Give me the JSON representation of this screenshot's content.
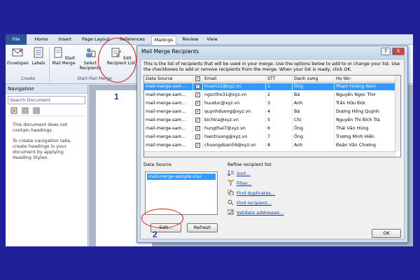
{
  "ribbon": {
    "tabs": [
      "File",
      "Home",
      "Insert",
      "Page Layout",
      "References",
      "Mailings",
      "Review",
      "View"
    ],
    "active_tab": "Mailings",
    "buttons": {
      "envelopes": "Envelopes",
      "labels": "Labels",
      "start_mail_merge": "Start Mail Merge",
      "select_recipients": "Select Recipients",
      "edit_recipient_list": "Edit Recipient List"
    },
    "groups": {
      "create": "Create",
      "start_mail_merge": "Start Mail Merge"
    }
  },
  "navigation": {
    "title": "Navigation",
    "search_placeholder": "Search Document",
    "message1": "This document does not contain headings.",
    "message2": "To create navigation tabs, create headings in your document by applying Heading Styles."
  },
  "dialog": {
    "title": "Mail Merge Recipients",
    "help_btn": "?",
    "close_btn": "X",
    "description": "This is the list of recipients that will be used in your merge.  Use the options below to add to or change your list.  Use the checkboxes to add or remove recipients from the merge.  When your list is ready, click OK.",
    "columns": [
      "Data Source",
      "",
      "Email",
      "STT",
      "Danh xưng",
      "Họ tên"
    ],
    "rows": [
      [
        "mail-merge-sam...",
        "hnam12@xyz.vn",
        "1",
        "Ông",
        "Phạm Hoàng Nam"
      ],
      [
        "mail-merge-sam...",
        "ngoctho31@xyz.vn",
        "2",
        "Bà",
        "Nguyễn Ngọc Thơ"
      ],
      [
        "mail-merge-sam...",
        "huuduc@xyz.vn",
        "3",
        "Anh",
        "Trần Hữu Đức"
      ],
      [
        "mail-merge-sam...",
        "quynhduong@xyz.vn",
        "4",
        "Bà",
        "Dương Hồng Quỳnh"
      ],
      [
        "mail-merge-sam...",
        "bichtra@xyz.vn",
        "5",
        "Chị",
        "Nguyễn Thị Bích Trà"
      ],
      [
        "mail-merge-sam...",
        "hungthai7@xyz.vn",
        "6",
        "Ông",
        "Thái Văn Hùng"
      ],
      [
        "mail-merge-sam...",
        "hientruong@xyz.vn",
        "7",
        "Ông",
        "Trương Minh Hiền"
      ],
      [
        "mail-merge-sam...",
        "chuongdoan59@xyz.vn",
        "8",
        "Anh",
        "Đoàn Văn Chương"
      ]
    ],
    "data_source_label": "Data Source",
    "data_source_item": "mail-merge-sample.xlsx",
    "edit_btn": "Edit...",
    "refresh_btn": "Refresh",
    "refine_label": "Refine recipient list",
    "refine_links": [
      "Sort...",
      "Filter...",
      "Find duplicates...",
      "Find recipient...",
      "Validate addresses..."
    ],
    "ok_btn": "OK"
  },
  "annotations": {
    "step1": "1",
    "step2": "2"
  },
  "colors": {
    "frame": "#20219a",
    "accent": "#2b5797",
    "selection": "#3399ff",
    "annotation": "#e3141a"
  }
}
